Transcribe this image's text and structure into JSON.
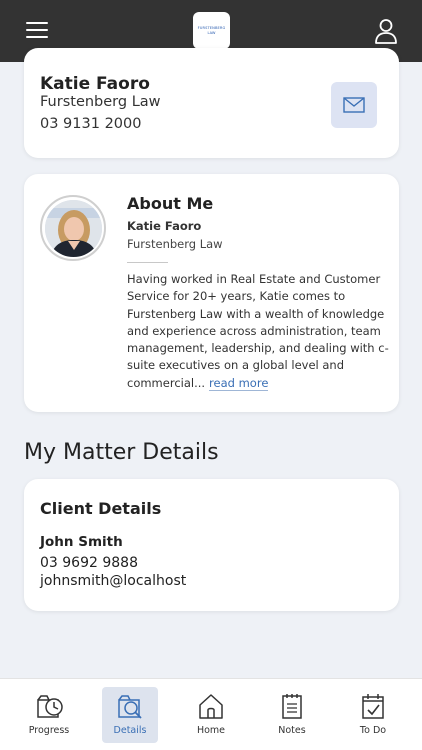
{
  "header": {
    "logo_line1": "FURSTENBERG",
    "logo_line2": "LAW"
  },
  "contact_card": {
    "name": "Katie Faoro",
    "firm": "Furstenberg Law",
    "phone": "03 9131 2000"
  },
  "about": {
    "title": "About Me",
    "name": "Katie Faoro",
    "firm": "Furstenberg Law",
    "bio": "Having worked in Real Estate and Customer Service for 20+ years, Katie comes to Furstenberg Law with a wealth of knowledge and experience across administration, team management, leadership, and dealing with c-suite executives on a global level and commercial...",
    "read_more": "read more"
  },
  "matter": {
    "section_title": "My Matter Details",
    "card_title": "Client Details",
    "client_name": "John Smith",
    "client_phone": "03 9692 9888",
    "client_email": "johnsmith@localhost"
  },
  "bottom_nav": {
    "items": [
      {
        "label": "Progress",
        "icon": "progress-clock-icon"
      },
      {
        "label": "Details",
        "icon": "details-search-icon"
      },
      {
        "label": "Home",
        "icon": "home-icon"
      },
      {
        "label": "Notes",
        "icon": "notes-icon"
      },
      {
        "label": "To Do",
        "icon": "todo-calendar-icon"
      }
    ],
    "active": "Details"
  },
  "colors": {
    "topbar": "#333333",
    "accent": "#3a6fb5",
    "background": "#eef1f6",
    "active_tab_bg": "#dde3ee"
  }
}
